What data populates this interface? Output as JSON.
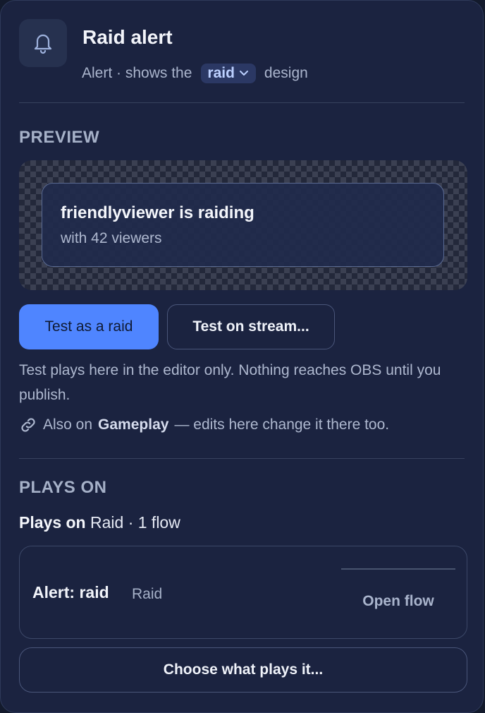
{
  "header": {
    "title": "Raid alert",
    "subtitle_prefix": "Alert · shows the",
    "design_value": "raid",
    "subtitle_suffix": "design",
    "icon": "bell-icon"
  },
  "preview": {
    "section_label": "PREVIEW",
    "alert_title": "friendlyviewer is raiding",
    "alert_subtitle": "with 42 viewers"
  },
  "actions": {
    "test_raid_label": "Test as a raid",
    "test_stream_label": "Test on stream..."
  },
  "help_text": "Test plays here in the editor only. Nothing reaches OBS until you publish.",
  "shared_note": {
    "icon": "link-icon",
    "prefix": "Also on",
    "scene": "Gameplay",
    "suffix": "— edits here change it there too."
  },
  "plays_on": {
    "section_label": "PLAYS ON",
    "bold_label": "Plays on",
    "summary": "Raid · 1 flow",
    "flows": [
      {
        "name": "Alert: raid",
        "trigger": "Raid",
        "action_label": "Open flow"
      }
    ],
    "choose_label": "Choose what plays it..."
  },
  "colors": {
    "accent": "#4f85ff",
    "panel_bg": "#1b2340",
    "design_pill_bg": "#2b3864"
  }
}
